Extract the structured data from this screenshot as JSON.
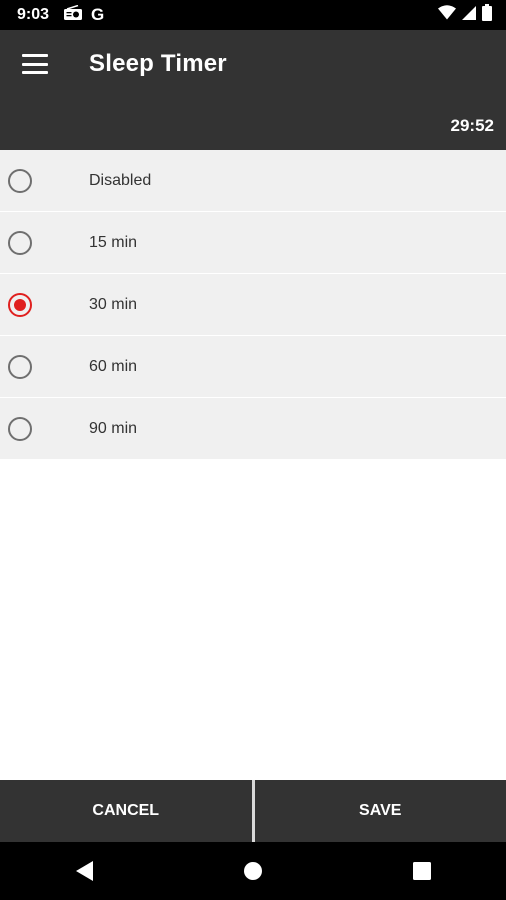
{
  "status_bar": {
    "time": "9:03",
    "g_letter": "G",
    "icons": [
      "radio-icon",
      "google-icon",
      "wifi-icon",
      "signal-icon",
      "battery-icon"
    ]
  },
  "app_bar": {
    "title": "Sleep Timer",
    "remaining": "29:52"
  },
  "options": [
    {
      "label": "Disabled",
      "selected": false
    },
    {
      "label": "15 min",
      "selected": false
    },
    {
      "label": "30 min",
      "selected": true
    },
    {
      "label": "60 min",
      "selected": false
    },
    {
      "label": "90 min",
      "selected": false
    }
  ],
  "buttons": {
    "cancel": "CANCEL",
    "save": "SAVE"
  },
  "colors": {
    "accent": "#e0201f",
    "app_bar": "#333333",
    "row_background": "#f0f0f0"
  }
}
